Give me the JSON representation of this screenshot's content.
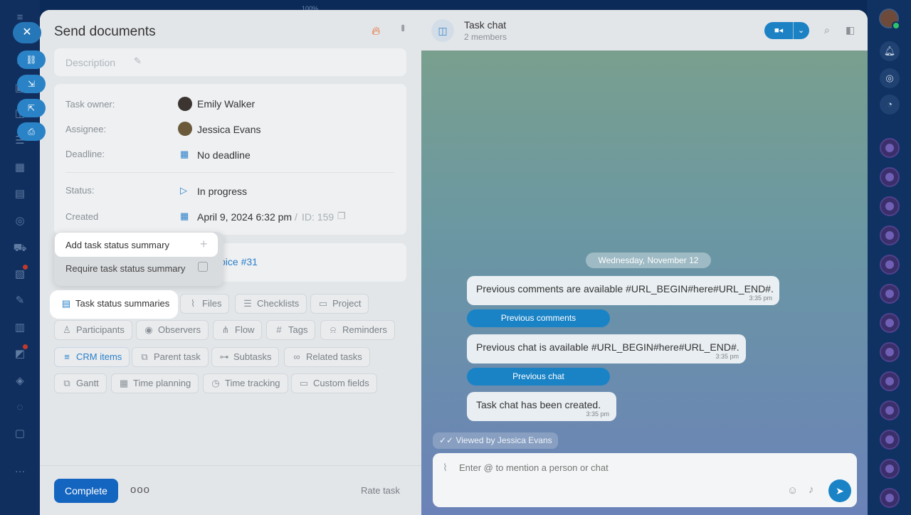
{
  "top_indicator": "100%",
  "task": {
    "title": "Send documents",
    "description_placeholder": "Description",
    "fields": {
      "owner_label": "Task owner:",
      "owner_value": "Emily Walker",
      "assignee_label": "Assignee:",
      "assignee_value": "Jessica Evans",
      "deadline_label": "Deadline:",
      "deadline_value": "No deadline",
      "status_label": "Status:",
      "status_value": "In progress",
      "created_label": "Created",
      "created_value": "April 9, 2024 6:32 pm",
      "id_separator": "/",
      "id_value": "ID: 159"
    },
    "linked_item": "voice #31"
  },
  "context_menu": {
    "items": [
      {
        "label": "Add task status summary",
        "icon": "plus-icon"
      },
      {
        "label": "Require task status summary",
        "icon": "summary-icon"
      }
    ]
  },
  "chips": {
    "task_status_summaries": "Task status summaries",
    "files": "Files",
    "checklists": "Checklists",
    "project": "Project",
    "participants": "Participants",
    "observers": "Observers",
    "flow": "Flow",
    "tags": "Tags",
    "reminders": "Reminders",
    "crm_items": "CRM items",
    "parent_task": "Parent task",
    "subtasks": "Subtasks",
    "related_tasks": "Related tasks",
    "gantt": "Gantt",
    "time_planning": "Time planning",
    "time_tracking": "Time tracking",
    "custom_fields": "Custom fields"
  },
  "footer": {
    "complete": "Complete",
    "more": "ooo",
    "rate_task": "Rate task"
  },
  "chat": {
    "title": "Task chat",
    "subtitle": "2 members",
    "date_divider": "Wednesday, November 12",
    "messages": [
      {
        "text": "Previous comments are available #URL_BEGIN#here#URL_END#.",
        "time": "3:35 pm"
      },
      {
        "text": "Previous chat is available #URL_BEGIN#here#URL_END#.",
        "time": "3:35 pm"
      },
      {
        "text": "Task chat has been created.",
        "time": "3:35 pm"
      }
    ],
    "buttons": {
      "previous_comments": "Previous comments",
      "previous_chat": "Previous chat"
    },
    "viewed_by": "Viewed by Jessica Evans",
    "input_placeholder": "Enter @ to mention a person or chat"
  },
  "colors": {
    "accent": "#1465c0",
    "chat_button": "#1a83c6",
    "fire": "#e45a1a",
    "online": "#2fc26b"
  }
}
